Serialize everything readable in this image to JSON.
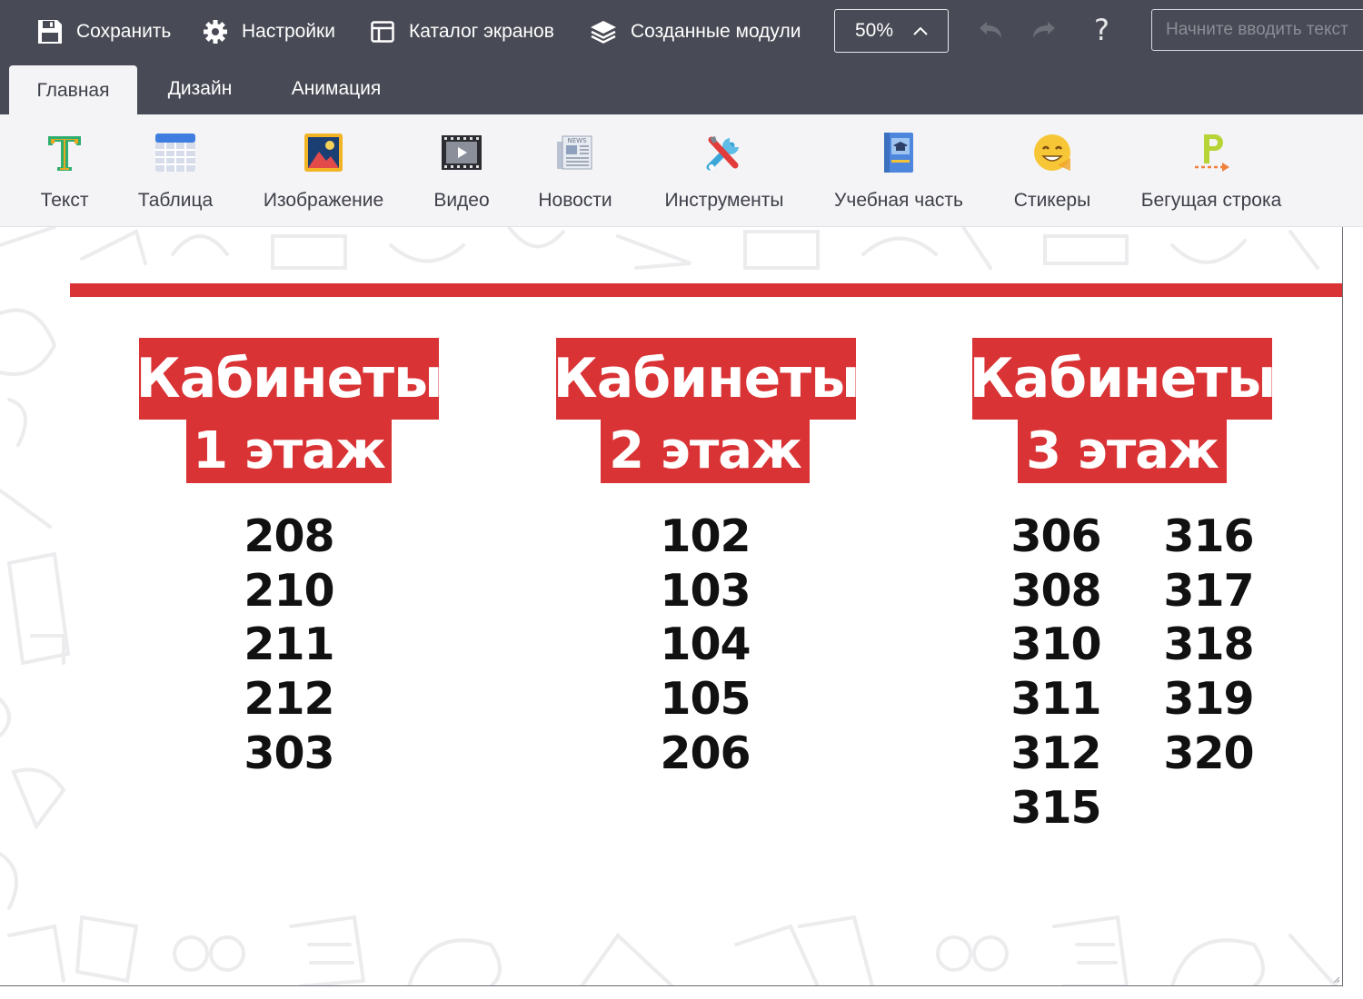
{
  "toolbar": {
    "save_label": "Сохранить",
    "settings_label": "Настройки",
    "catalog_label": "Каталог экранов",
    "modules_label": "Созданные модули",
    "zoom_value": "50%",
    "help_label": "?",
    "search_placeholder": "Начните вводить текст"
  },
  "tabs": [
    {
      "label": "Главная",
      "active": true
    },
    {
      "label": "Дизайн",
      "active": false
    },
    {
      "label": "Анимация",
      "active": false
    }
  ],
  "ribbon": {
    "items": [
      {
        "label": "Текст",
        "icon": "text-icon"
      },
      {
        "label": "Таблица",
        "icon": "table-icon"
      },
      {
        "label": "Изображение",
        "icon": "image-icon"
      },
      {
        "label": "Видео",
        "icon": "video-icon"
      },
      {
        "label": "Новости",
        "icon": "news-icon"
      },
      {
        "label": "Инструменты",
        "icon": "tools-icon"
      },
      {
        "label": "Учебная часть",
        "icon": "study-book-icon"
      },
      {
        "label": "Стикеры",
        "icon": "sticker-smile-icon"
      },
      {
        "label": "Бегущая строка",
        "icon": "ticker-icon"
      }
    ]
  },
  "slide": {
    "accent_color": "#d93335",
    "floors": [
      {
        "title": "Кабинеты",
        "floor": "1 этаж",
        "rooms": [
          "208",
          "210",
          "211",
          "212",
          "303"
        ]
      },
      {
        "title": "Кабинеты",
        "floor": "2 этаж",
        "rooms": [
          "102",
          "103",
          "104",
          "105",
          "206"
        ]
      },
      {
        "title": "Кабинеты",
        "floor": "3 этаж",
        "rooms": [
          "306",
          "308",
          "310",
          "311",
          "312",
          "315"
        ],
        "rooms_col2": [
          "316",
          "317",
          "318",
          "319",
          "320"
        ]
      }
    ]
  }
}
